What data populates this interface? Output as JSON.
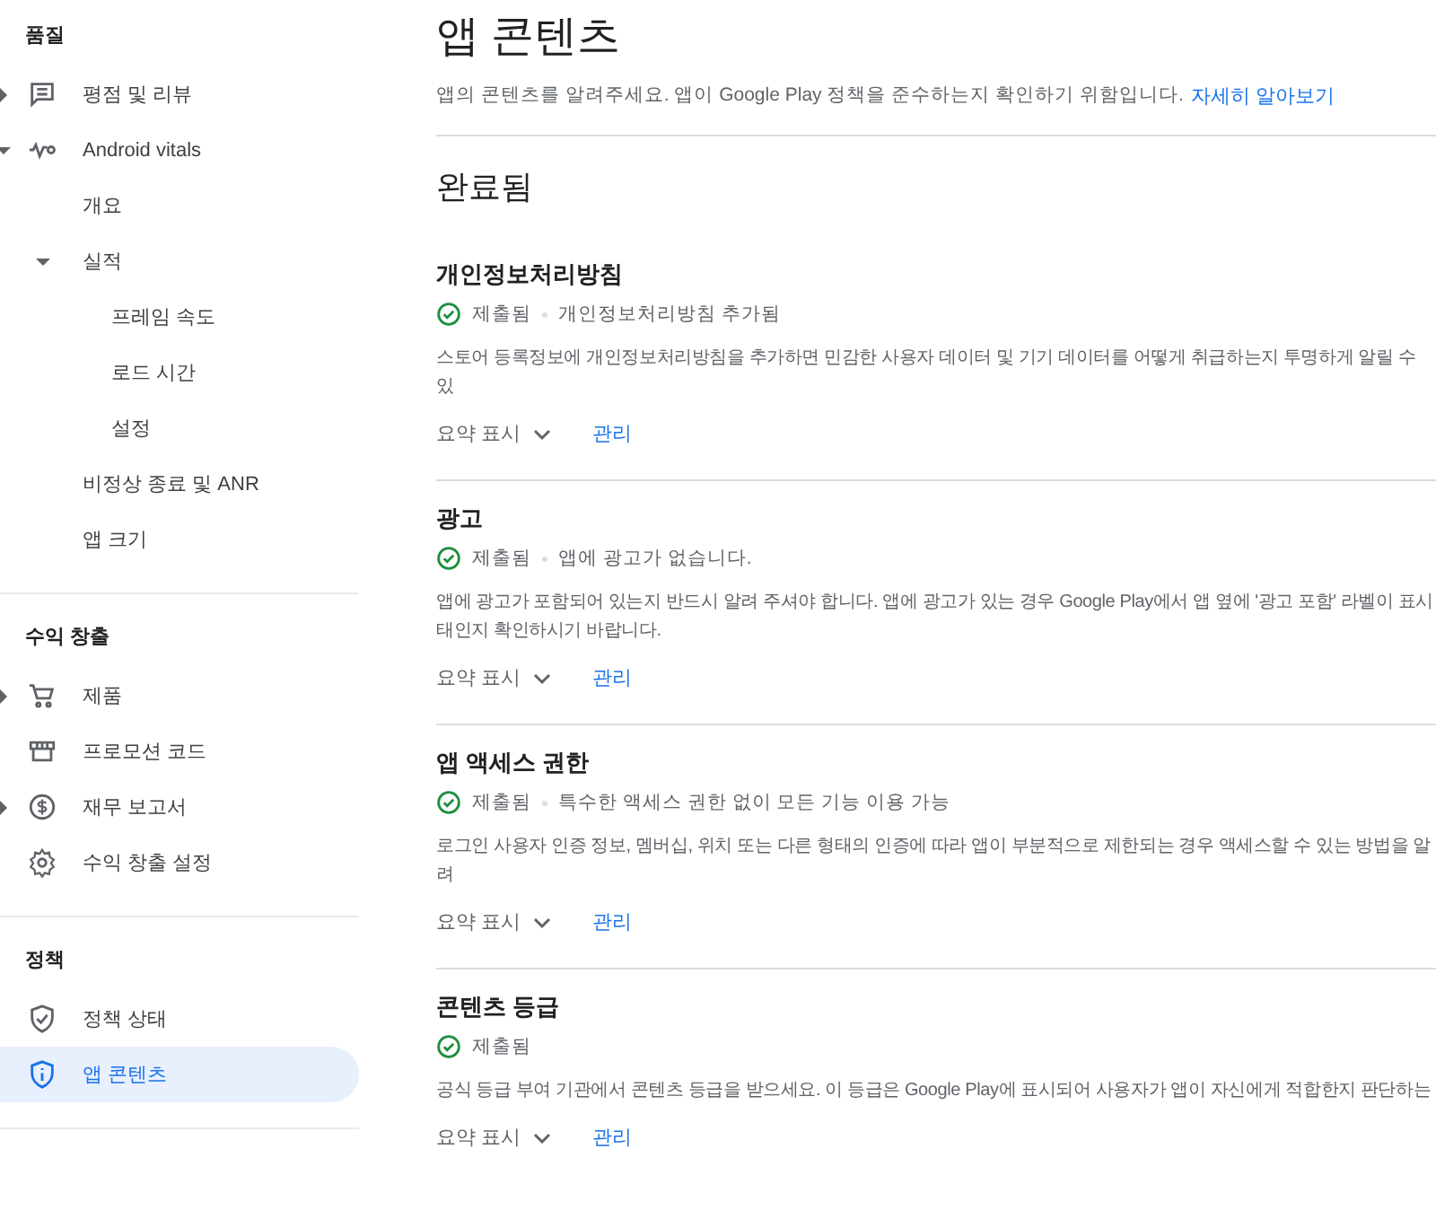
{
  "sidebar": {
    "sections": [
      {
        "title": "품질",
        "items": [
          {
            "label": "평점 및 리뷰",
            "expanded": false,
            "selected": false
          },
          {
            "label": "Android vitals",
            "expanded": true,
            "selected": false,
            "children": [
              {
                "label": "개요",
                "selected": false
              },
              {
                "label": "실적",
                "expanded": true,
                "selected": false,
                "children": [
                  {
                    "label": "프레임 속도",
                    "selected": false
                  },
                  {
                    "label": "로드 시간",
                    "selected": false
                  },
                  {
                    "label": "설정",
                    "selected": false
                  }
                ]
              },
              {
                "label": "비정상 종료 및 ANR",
                "selected": false
              },
              {
                "label": "앱 크기",
                "selected": false
              }
            ]
          }
        ]
      },
      {
        "title": "수익 창출",
        "items": [
          {
            "label": "제품",
            "expanded": false,
            "selected": false
          },
          {
            "label": "프로모션 코드",
            "selected": false
          },
          {
            "label": "재무 보고서",
            "expanded": false,
            "selected": false
          },
          {
            "label": "수익 창출 설정",
            "selected": false
          }
        ]
      },
      {
        "title": "정책",
        "items": [
          {
            "label": "정책 상태",
            "selected": false
          },
          {
            "label": "앱 콘텐츠",
            "selected": true
          }
        ]
      }
    ]
  },
  "page": {
    "title": "앱 콘텐츠",
    "intro": "앱의 콘텐츠를 알려주세요. 앱이 Google Play 정책을 준수하는지 확인하기 위함입니다.",
    "intro_link": "자세히 알아보기",
    "section_title": "완료됨"
  },
  "cards": [
    {
      "title": "개인정보처리방침",
      "status": "제출됨",
      "status_detail": "개인정보처리방침 추가됨",
      "description": "스토어 등록정보에 개인정보처리방침을 추가하면 민감한 사용자 데이터 및 기기 데이터를 어떻게 취급하는지 투명하게 알릴 수 있",
      "toggle": "요약 표시",
      "link": "관리"
    },
    {
      "title": "광고",
      "status": "제출됨",
      "status_detail": "앱에 광고가 없습니다.",
      "description": "앱에 광고가 포함되어 있는지 반드시 알려 주셔야 합니다. 앱에 광고가 있는 경우 Google Play에서 앱 옆에 '광고 포함' 라벨이 표시 태인지 확인하시기 바랍니다.",
      "toggle": "요약 표시",
      "link": "관리"
    },
    {
      "title": "앱 액세스 권한",
      "status": "제출됨",
      "status_detail": "특수한 액세스 권한 없이 모든 기능 이용 가능",
      "description": "로그인 사용자 인증 정보, 멤버십, 위치 또는 다른 형태의 인증에 따라 앱이 부분적으로 제한되는 경우 액세스할 수 있는 방법을 알려",
      "toggle": "요약 표시",
      "link": "관리"
    },
    {
      "title": "콘텐츠 등급",
      "status": "제출됨",
      "description": "공식 등급 부여 기관에서 콘텐츠 등급을 받으세요. 이 등급은 Google Play에 표시되어 사용자가 앱이 자신에게 적합한지 판단하는",
      "toggle": "요약 표시",
      "link": "관리"
    }
  ]
}
